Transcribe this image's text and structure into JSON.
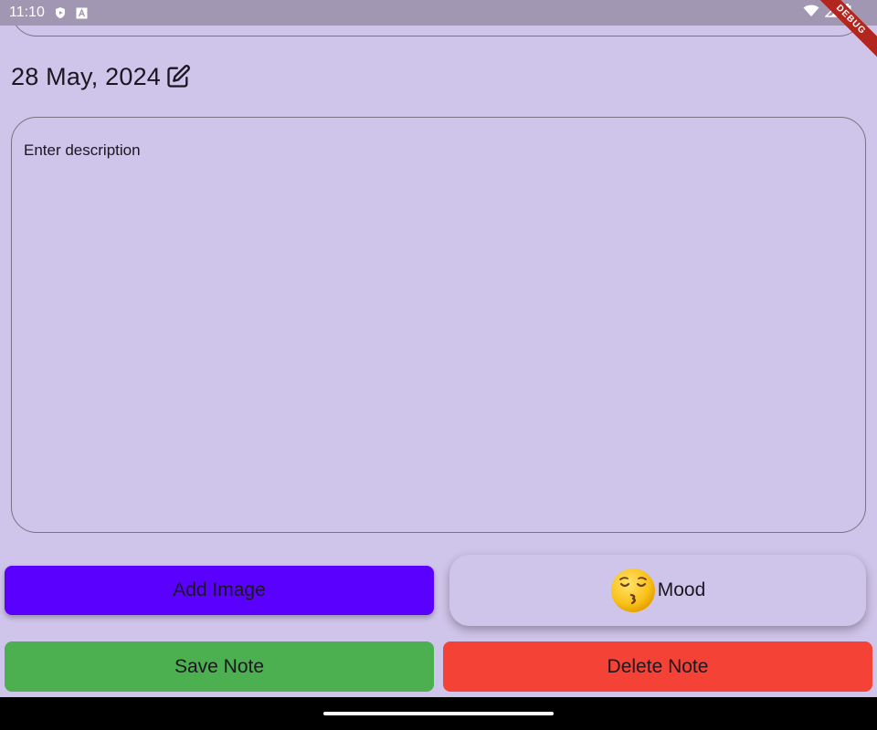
{
  "status_bar": {
    "time": "11:10",
    "icons": [
      "play-protect-icon",
      "keyboard-a-icon",
      "wifi-icon",
      "signal-icon",
      "battery-icon"
    ]
  },
  "debug_banner": "DEBUG",
  "note": {
    "date": "28 May, 2024",
    "description_placeholder": "Enter description",
    "description_value": ""
  },
  "buttons": {
    "add_image": "Add Image",
    "mood": "Mood",
    "save": "Save Note",
    "delete": "Delete Note"
  },
  "colors": {
    "background": "#cfc4e9",
    "status_bar": "#a197b3",
    "add_image": "#5a00ff",
    "save": "#4caf50",
    "delete": "#f44336",
    "debug": "#b3261e"
  },
  "mood_icon": "kissing-face-closed-eyes-icon"
}
